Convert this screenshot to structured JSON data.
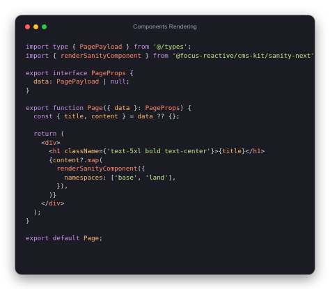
{
  "window": {
    "title": "Components Rendering"
  },
  "code_lines": [
    [
      [
        "import",
        "kw"
      ],
      [
        " ",
        "pun"
      ],
      [
        "type",
        "kw"
      ],
      [
        " { ",
        "pun"
      ],
      [
        "PagePayload",
        "ty"
      ],
      [
        " } ",
        "pun"
      ],
      [
        "from",
        "kw"
      ],
      [
        " ",
        "pun"
      ],
      [
        "'@/types'",
        "str"
      ],
      [
        ";",
        "pun"
      ]
    ],
    [
      [
        "import",
        "kw"
      ],
      [
        " { ",
        "pun"
      ],
      [
        "renderSanityComponent",
        "fn"
      ],
      [
        " } ",
        "pun"
      ],
      [
        "from",
        "kw"
      ],
      [
        " ",
        "pun"
      ],
      [
        "'@focus-reactive/cms-kit/sanity-next'",
        "str"
      ],
      [
        ";",
        "pun"
      ]
    ],
    [],
    [
      [
        "export",
        "kw"
      ],
      [
        " ",
        "pun"
      ],
      [
        "interface",
        "kw"
      ],
      [
        " ",
        "pun"
      ],
      [
        "PageProps",
        "ty"
      ],
      [
        " {",
        "pun"
      ]
    ],
    [
      [
        "  ",
        "pun"
      ],
      [
        "data",
        "var"
      ],
      [
        ": ",
        "pun"
      ],
      [
        "PagePayload",
        "ty"
      ],
      [
        " | ",
        "pun"
      ],
      [
        "null",
        "kw"
      ],
      [
        ";",
        "pun"
      ]
    ],
    [
      [
        "}",
        "pun"
      ]
    ],
    [],
    [
      [
        "export",
        "kw"
      ],
      [
        " ",
        "pun"
      ],
      [
        "function",
        "kw"
      ],
      [
        " ",
        "pun"
      ],
      [
        "Page",
        "fn"
      ],
      [
        "({ ",
        "pun"
      ],
      [
        "data",
        "var"
      ],
      [
        " }: ",
        "pun"
      ],
      [
        "PageProps",
        "ty"
      ],
      [
        ") {",
        "pun"
      ]
    ],
    [
      [
        "  ",
        "pun"
      ],
      [
        "const",
        "kw"
      ],
      [
        " { ",
        "pun"
      ],
      [
        "title",
        "var"
      ],
      [
        ", ",
        "pun"
      ],
      [
        "content",
        "var"
      ],
      [
        " } = ",
        "pun"
      ],
      [
        "data",
        "var"
      ],
      [
        " ?? {};",
        "pun"
      ]
    ],
    [],
    [
      [
        "  ",
        "pun"
      ],
      [
        "return",
        "kw"
      ],
      [
        " (",
        "pun"
      ]
    ],
    [
      [
        "    <",
        "pun"
      ],
      [
        "div",
        "tag"
      ],
      [
        ">",
        "pun"
      ]
    ],
    [
      [
        "      <",
        "pun"
      ],
      [
        "h1",
        "tag"
      ],
      [
        " ",
        "pun"
      ],
      [
        "className",
        "attr"
      ],
      [
        "={",
        "pun"
      ],
      [
        "'text-5xl bold text-center'",
        "str"
      ],
      [
        "}>{",
        "pun"
      ],
      [
        "title",
        "var"
      ],
      [
        "}</",
        "pun"
      ],
      [
        "h1",
        "tag"
      ],
      [
        ">",
        "pun"
      ]
    ],
    [
      [
        "      {",
        "pun"
      ],
      [
        "content",
        "var"
      ],
      [
        "?.",
        "pun"
      ],
      [
        "map",
        "fn"
      ],
      [
        "(",
        "pun"
      ]
    ],
    [
      [
        "        ",
        "pun"
      ],
      [
        "renderSanityComponent",
        "fn"
      ],
      [
        "({",
        "pun"
      ]
    ],
    [
      [
        "          ",
        "pun"
      ],
      [
        "namespaces",
        "var"
      ],
      [
        ": [",
        "pun"
      ],
      [
        "'base'",
        "str"
      ],
      [
        ", ",
        "pun"
      ],
      [
        "'land'",
        "str"
      ],
      [
        "],",
        "pun"
      ]
    ],
    [
      [
        "        }),",
        "pun"
      ]
    ],
    [
      [
        "      )}",
        "pun"
      ]
    ],
    [
      [
        "    </",
        "pun"
      ],
      [
        "div",
        "tag"
      ],
      [
        ">",
        "pun"
      ]
    ],
    [
      [
        "  );",
        "pun"
      ]
    ],
    [
      [
        "}",
        "pun"
      ]
    ],
    [],
    [
      [
        "export",
        "kw"
      ],
      [
        " ",
        "pun"
      ],
      [
        "default",
        "kw"
      ],
      [
        " ",
        "pun"
      ],
      [
        "Page",
        "var"
      ],
      [
        ";",
        "pun"
      ]
    ]
  ]
}
